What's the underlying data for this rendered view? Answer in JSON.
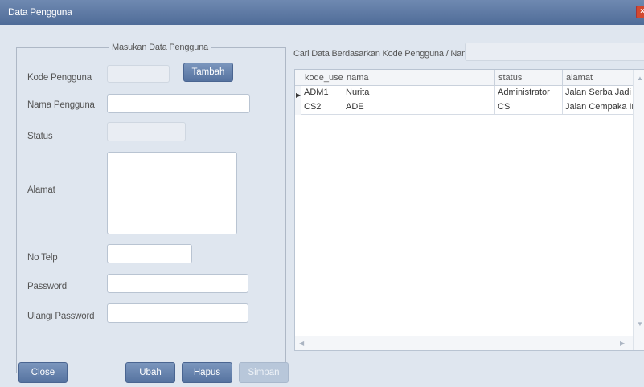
{
  "window": {
    "title": "Data Pengguna",
    "close_icon": "close-icon"
  },
  "form": {
    "group_title": "Masukan Data Pengguna",
    "kode_label": "Kode Pengguna",
    "kode_value": "",
    "tambah_label": "Tambah",
    "nama_label": "Nama Pengguna",
    "nama_value": "",
    "status_label": "Status",
    "status_value": "",
    "alamat_label": "Alamat",
    "alamat_value": "",
    "notelp_label": "No Telp",
    "notelp_value": "",
    "password_label": "Password",
    "password_value": "",
    "ulangi_label": "Ulangi Password",
    "ulangi_value": ""
  },
  "search": {
    "label": "Cari Data Berdasarkan Kode Pengguna / Nama",
    "value": ""
  },
  "grid": {
    "columns": [
      "kode_user",
      "nama",
      "status",
      "alamat"
    ],
    "rows": [
      [
        "ADM1",
        "Nurita",
        "Administrator",
        "Jalan Serba Jadi No."
      ],
      [
        "CS2",
        "ADE",
        "CS",
        "Jalan Cempaka Indo"
      ]
    ],
    "selected_row": 0
  },
  "buttons": {
    "close": "Close",
    "ubah": "Ubah",
    "hapus": "Hapus",
    "simpan": "Simpan"
  }
}
